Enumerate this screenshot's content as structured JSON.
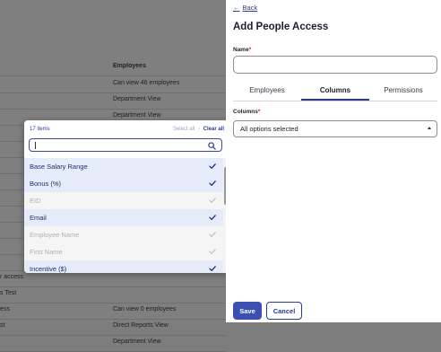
{
  "background_table": {
    "header": {
      "left": "",
      "right": "Employees"
    },
    "rows": [
      {
        "left": "",
        "right": "Can view 46 employees"
      },
      {
        "left": "",
        "right": "Department View"
      },
      {
        "left": "",
        "right": "Department View"
      },
      {
        "left": "",
        "right": ""
      },
      {
        "left": "",
        "right": ""
      },
      {
        "left": "",
        "right": ""
      },
      {
        "left": "",
        "right": ""
      },
      {
        "left": "",
        "right": ""
      },
      {
        "left": "",
        "right": ""
      },
      {
        "left": "",
        "right": ""
      },
      {
        "left": "",
        "right": ""
      },
      {
        "left": "",
        "right": ""
      },
      {
        "left": "r access",
        "right": ""
      },
      {
        "left": "s Test",
        "right": ""
      },
      {
        "left": "ess",
        "right": "Can view 0 employees"
      },
      {
        "left": "st",
        "right": "Direct Reports View"
      },
      {
        "left": "",
        "right": "Department View"
      }
    ]
  },
  "dropdown": {
    "count": "17 items",
    "select_all": "Select all",
    "separator": "-",
    "clear_all": "Clear all",
    "search_value": "",
    "items": [
      {
        "label": "Base Salary Range",
        "state": "selected"
      },
      {
        "label": "Bonus (%)",
        "state": "selected"
      },
      {
        "label": "EID",
        "state": "disabled"
      },
      {
        "label": "Email",
        "state": "selected"
      },
      {
        "label": "Employee Name",
        "state": "disabled"
      },
      {
        "label": "First Name",
        "state": "disabled"
      },
      {
        "label": "Incentive ($)",
        "state": "selected"
      }
    ],
    "scroll_position": 0.12
  },
  "panel": {
    "back_label": "Back",
    "title": "Add People Access",
    "name_label": "Name",
    "name_required": "*",
    "name_value": "",
    "tabs": [
      "Employees",
      "Columns",
      "Permissions"
    ],
    "active_tab": "Columns",
    "columns_label": "Columns",
    "columns_required": "*",
    "columns_value": "All options selected",
    "save_label": "Save",
    "cancel_label": "Cancel"
  },
  "colors": {
    "accent": "#2b3b8f",
    "primary_button": "#3b4fb0",
    "selected_row": "#e6ebf9",
    "required": "#d0281b"
  }
}
